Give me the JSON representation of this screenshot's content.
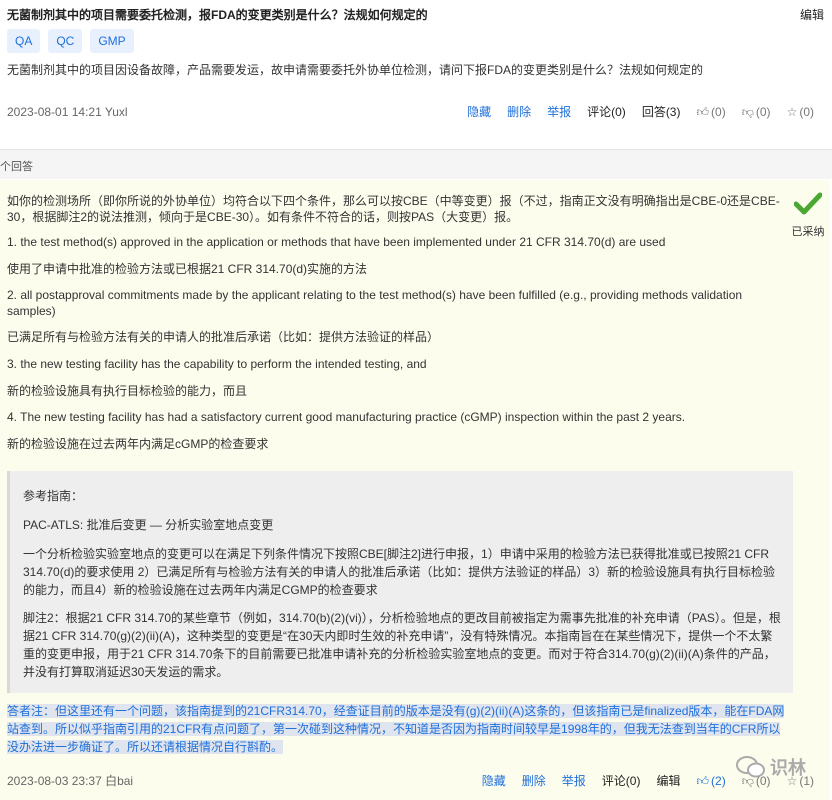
{
  "question": {
    "title": "无菌制剂其中的项目需要委托检测，报FDA的变更类别是什么？法规如何规定的",
    "edit_label": "编辑",
    "tags": [
      "QA",
      "QC",
      "GMP"
    ],
    "body": "无菌制剂其中的项目因设备故障，产品需要发运，故申请需要委托外协单位检测，请问下报FDA的变更类别是什么？法规如何规定的",
    "meta": "2023-08-01 14:21  Yuxl",
    "actions": {
      "hide": "隐藏",
      "delete": "删除",
      "report": "举报",
      "comment": "评论(0)",
      "answer": "回答(3)",
      "like": "(0)",
      "dislike": "(0)",
      "favorite": "(0)"
    }
  },
  "answers_count_label": "个回答",
  "answer": {
    "accepted_label": "已采纳",
    "paragraphs": [
      "如你的检测场所（即你所说的外协单位）均符合以下四个条件，那么可以按CBE（中等变更）报（不过，指南正文没有明确指出是CBE-0还是CBE-30，根据脚注2的说法推测，倾向于是CBE-30）。如有条件不符合的话，则按PAS（大变更）报。",
      "1. the test method(s) approved in the application or methods that have been implemented under 21 CFR 314.70(d) are used",
      "使用了申请中批准的检验方法或已根据21 CFR 314.70(d)实施的方法",
      "2. all postapproval commitments made by the applicant relating to the test method(s) have been fulfilled (e.g., providing methods validation samples)",
      "已满足所有与检验方法有关的申请人的批准后承诺（比如：提供方法验证的样品）",
      "3. the new testing facility has the capability to perform the intended testing, and",
      "新的检验设施具有执行目标检验的能力，而且",
      "4. The new testing facility has had a satisfactory current good manufacturing practice (cGMP) inspection within the past 2 years.",
      "新的检验设施在过去两年内满足cGMP的检查要求"
    ],
    "reference": {
      "heading": "参考指南：",
      "link": "PAC-ATLS: 批准后变更 — 分析实验室地点变更",
      "para1": "一个分析检验实验室地点的变更可以在满足下列条件情况下按照CBE[脚注2]进行申报，1）申请中采用的检验方法已获得批准或已按照21 CFR 314.70(d)的要求使用 2）已满足所有与检验方法有关的申请人的批准后承诺（比如：提供方法验证的样品）3）新的检验设施具有执行目标检验的能力，而且4）新的检验设施在过去两年内满足CGMP的检查要求",
      "para2": "脚注2：根据21 CFR 314.70的某些章节（例如，314.70(b)(2)(vi)），分析检验地点的更改目前被指定为需事先批准的补充申请（PAS）。但是，根据21 CFR 314.70(g)(2)(ii)(A)，这种类型的变更是“在30天内即时生效的补充申请”，没有特殊情况。本指南旨在在某些情况下，提供一个不太繁重的变更申报，用于21 CFR 314.70条下的目前需要已批准申请补充的分析检验实验室地点的变更。而对于符合314.70(g)(2)(ii)(A)条件的产品，并没有打算取消延迟30天发运的需求。"
    },
    "note": "答者注：但这里还有一个问题，该指南提到的21CFR314.70，经查证目前的版本是没有(g)(2)(ii)(A)这条的，但该指南已是finalized版本，能在FDA网站查到。所以似乎指南引用的21CFR有点问题了，第一次碰到这种情况，不知道是否因为指南时间较早是1998年的，但我无法查到当年的CFR所以没办法进一步确证了。所以还请根据情况自行斟酌。",
    "meta": "2023-08-03 23:37  白bai",
    "actions": {
      "hide": "隐藏",
      "delete": "删除",
      "report": "举报",
      "comment": "评论(0)",
      "edit": "编辑",
      "like": "(2)",
      "dislike": "(0)",
      "favorite": "(1)"
    }
  },
  "watermark": "识林"
}
